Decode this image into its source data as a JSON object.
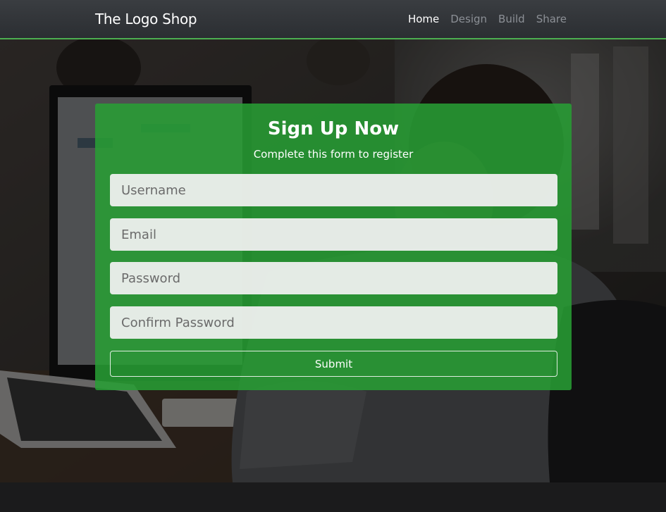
{
  "navbar": {
    "brand": "The Logo Shop",
    "links": [
      {
        "label": "Home",
        "active": true
      },
      {
        "label": "Design",
        "active": false
      },
      {
        "label": "Build",
        "active": false
      },
      {
        "label": "Share",
        "active": false
      }
    ],
    "accent_color": "#4caf50"
  },
  "signup": {
    "title": "Sign Up Now",
    "subtitle": "Complete this form to register",
    "fields": [
      {
        "placeholder": "Username",
        "value": ""
      },
      {
        "placeholder": "Email",
        "value": ""
      },
      {
        "placeholder": "Password",
        "value": ""
      },
      {
        "placeholder": "Confirm Password",
        "value": ""
      }
    ],
    "submit_label": "Submit",
    "card_color": "#28a034"
  }
}
